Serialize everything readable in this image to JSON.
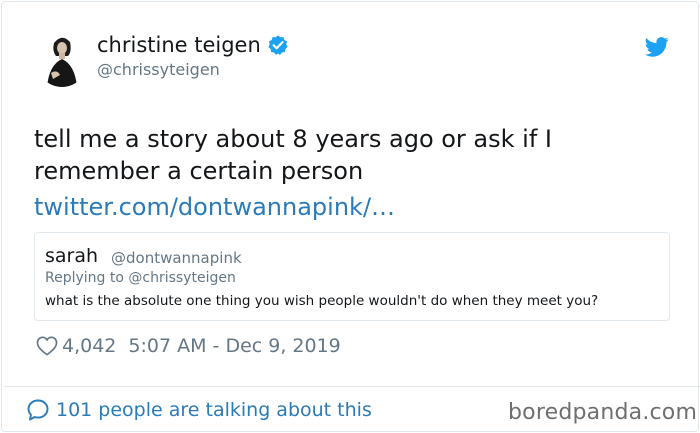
{
  "author": {
    "display_name": "christine teigen",
    "handle": "@chrissyteigen"
  },
  "tweet": {
    "text": "tell me a story about 8 years ago or ask if I remember a certain person",
    "link": "twitter.com/dontwannapink/…"
  },
  "quoted": {
    "name": "sarah",
    "handle": "@dontwannapink",
    "reply_to": "Replying to @chrissyteigen",
    "text": "what is the absolute one thing you wish people wouldn't do when they meet you?"
  },
  "meta": {
    "likes": "4,042",
    "timestamp": "5:07 AM - Dec 9, 2019"
  },
  "footer": {
    "talking": "101 people are talking about this",
    "watermark": "boredpanda.com"
  },
  "colors": {
    "link": "#2b7bb9",
    "muted": "#657786",
    "verified": "#1da1f2",
    "border": "#e1e8ed"
  },
  "icons": [
    "verified-badge-icon",
    "twitter-bird-icon",
    "heart-icon",
    "speech-bubble-icon"
  ]
}
